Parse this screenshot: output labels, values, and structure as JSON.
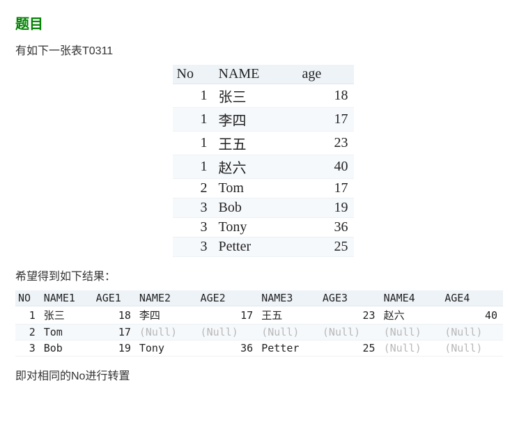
{
  "heading": "题目",
  "intro": "有如下一张表T0311",
  "table1": {
    "headers": [
      "No",
      "NAME",
      "age"
    ],
    "rows": [
      {
        "no": 1,
        "name": "张三",
        "age": 18
      },
      {
        "no": 1,
        "name": "李四",
        "age": 17
      },
      {
        "no": 1,
        "name": "王五",
        "age": 23
      },
      {
        "no": 1,
        "name": "赵六",
        "age": 40
      },
      {
        "no": 2,
        "name": "Tom",
        "age": 17
      },
      {
        "no": 3,
        "name": "Bob",
        "age": 19
      },
      {
        "no": 3,
        "name": "Tony",
        "age": 36
      },
      {
        "no": 3,
        "name": "Petter",
        "age": 25
      }
    ]
  },
  "midtext": "希望得到如下结果：",
  "table2": {
    "headers": [
      "NO",
      "NAME1",
      "AGE1",
      "NAME2",
      "AGE2",
      "NAME3",
      "AGE3",
      "NAME4",
      "AGE4"
    ],
    "null_label": "(Null)",
    "rows": [
      {
        "no": 1,
        "name1": "张三",
        "age1": 18,
        "name2": "李四",
        "age2": 17,
        "name3": "王五",
        "age3": 23,
        "name4": "赵六",
        "age4": 40
      },
      {
        "no": 2,
        "name1": "Tom",
        "age1": 17,
        "name2": null,
        "age2": null,
        "name3": null,
        "age3": null,
        "name4": null,
        "age4": null
      },
      {
        "no": 3,
        "name1": "Bob",
        "age1": 19,
        "name2": "Tony",
        "age2": 36,
        "name3": "Petter",
        "age3": 25,
        "name4": null,
        "age4": null
      }
    ]
  },
  "conclusion": "即对相同的No进行转置"
}
